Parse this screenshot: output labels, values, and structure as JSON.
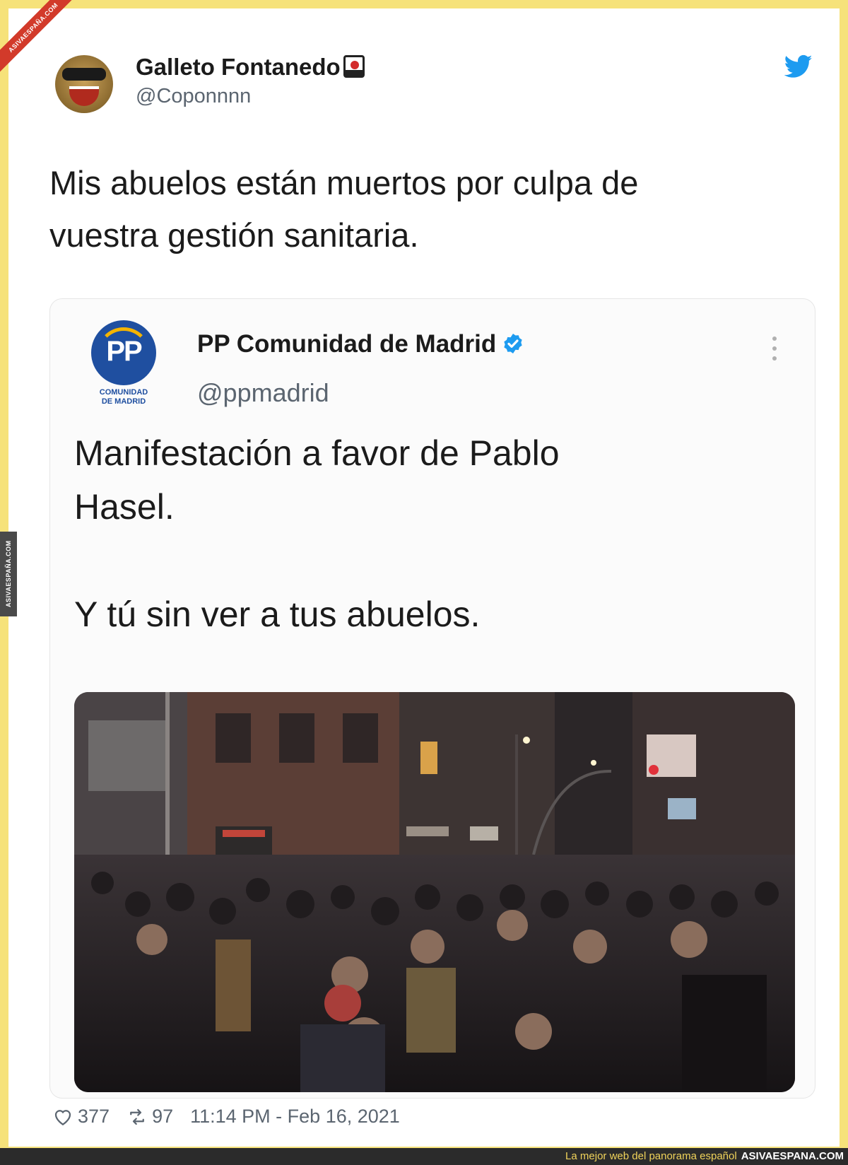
{
  "watermark": {
    "ribbon": "ASIVAESPAÑA.COM",
    "side_badge": "ASIVAESPAÑA.COM",
    "footer_tagline": "La mejor web del panorama español",
    "footer_site": "ASIVAESPANA.COM"
  },
  "tweet": {
    "display_name": "Galleto Fontanedo",
    "handle": "@Coponnnn",
    "text_line1": "Mis abuelos están muertos por culpa de",
    "text_line2": "vuestra gestión sanitaria.",
    "likes": "377",
    "retweets": "97",
    "timestamp": "11:14 PM - Feb 16, 2021"
  },
  "quoted": {
    "logo_text": "PP",
    "logo_sub1": "COMUNIDAD",
    "logo_sub2": "DE MADRID",
    "display_name": "PP Comunidad de Madrid",
    "handle": "@ppmadrid",
    "text_line1": "Manifestación a favor de Pablo",
    "text_line2": "Hasel.",
    "text_line3": "Y tú sin ver a tus abuelos."
  },
  "colors": {
    "frame_border": "#f6e27a",
    "twitter_blue": "#1d9bf0",
    "pp_blue": "#1f4fa0",
    "verified_blue": "#1d9bf0"
  }
}
